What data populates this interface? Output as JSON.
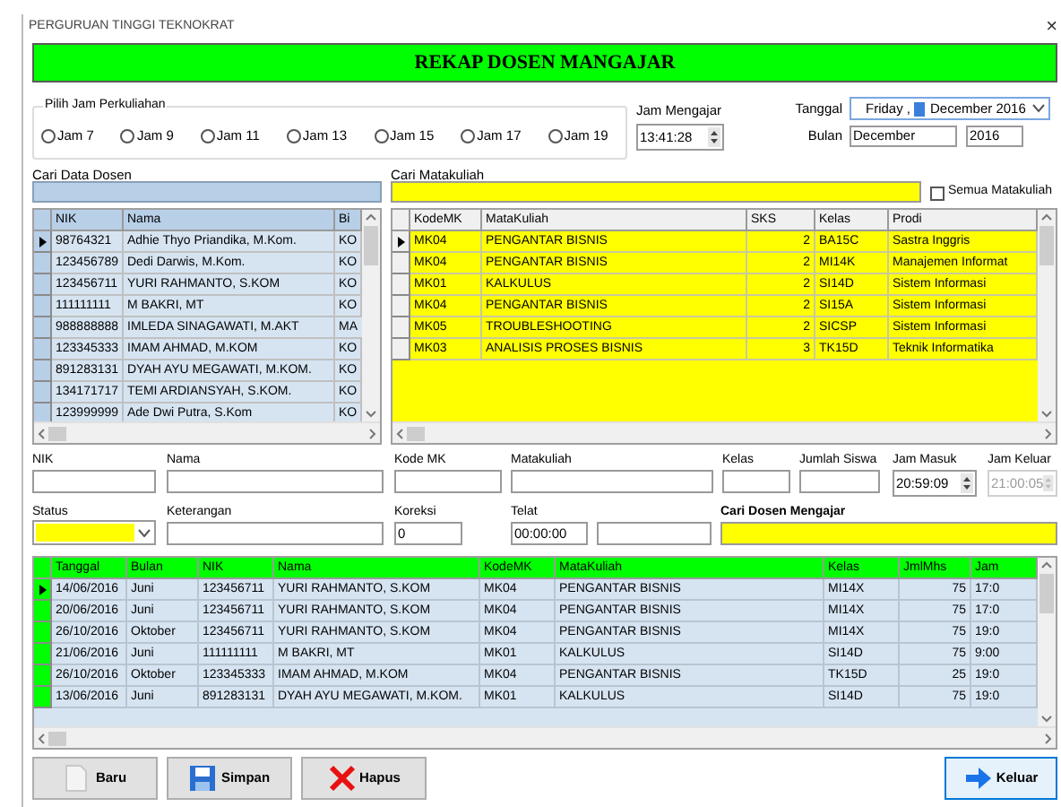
{
  "window": {
    "title": "PERGURUAN TINGGI TEKNOKRAT",
    "close": "×"
  },
  "banner": {
    "title": "REKAP DOSEN MANGAJAR"
  },
  "jam_group": {
    "label": "Pilih Jam Perkuliahan",
    "options": [
      {
        "label": "Jam 7",
        "selected": false
      },
      {
        "label": "Jam 9",
        "selected": false
      },
      {
        "label": "Jam 11",
        "selected": false
      },
      {
        "label": "Jam 13",
        "selected": false
      },
      {
        "label": "Jam 15",
        "selected": false
      },
      {
        "label": "Jam 17",
        "selected": false
      },
      {
        "label": "Jam 19",
        "selected": false
      }
    ]
  },
  "jam_mengajar": {
    "label": "Jam Mengajar",
    "value": "13:41:28"
  },
  "tanggal": {
    "label": "Tanggal",
    "day": "Friday ,",
    "date": "December 2016"
  },
  "bulan": {
    "label": "Bulan",
    "month": "December",
    "year": "2016"
  },
  "cari_dosen": {
    "label": "Cari Data Dosen"
  },
  "cari_matakuliah": {
    "label": "Cari Matakuliah"
  },
  "semua_matakuliah": {
    "label": "Semua Matakuliah",
    "checked": false
  },
  "dosen_table": {
    "columns": [
      "NIK",
      "Nama",
      "Bi"
    ],
    "rows": [
      {
        "current": true,
        "cells": [
          "98764321",
          "Adhie Thyo Priandika, M.Kom.",
          "KO"
        ]
      },
      {
        "current": false,
        "cells": [
          "123456789",
          "Dedi Darwis, M.Kom.",
          "KO"
        ]
      },
      {
        "current": false,
        "cells": [
          "123456711",
          "YURI RAHMANTO, S.KOM",
          "KO"
        ]
      },
      {
        "current": false,
        "cells": [
          "111111111",
          "M BAKRI, MT",
          "KO"
        ]
      },
      {
        "current": false,
        "cells": [
          "988888888",
          "IMLEDA SINAGAWATI, M.AKT",
          "MA"
        ]
      },
      {
        "current": false,
        "cells": [
          "123345333",
          "IMAM AHMAD, M.KOM",
          "KO"
        ]
      },
      {
        "current": false,
        "cells": [
          "891283131",
          "DYAH AYU MEGAWATI, M.KOM.",
          "KO"
        ]
      },
      {
        "current": false,
        "cells": [
          "134171717",
          "TEMI ARDIANSYAH, S.KOM.",
          "KO"
        ]
      },
      {
        "current": false,
        "cells": [
          "123999999",
          "Ade Dwi Putra, S.Kom",
          "KO"
        ]
      }
    ]
  },
  "matakuliah_table": {
    "columns": [
      "KodeMK",
      "MataKuliah",
      "SKS",
      "Kelas",
      "Prodi"
    ],
    "rows": [
      {
        "current": true,
        "cells": [
          "MK04",
          "PENGANTAR BISNIS",
          "2",
          "BA15C",
          "Sastra Inggris"
        ]
      },
      {
        "current": false,
        "cells": [
          "MK04",
          "PENGANTAR BISNIS",
          "2",
          "MI14K",
          "Manajemen Informat"
        ]
      },
      {
        "current": false,
        "cells": [
          "MK01",
          "KALKULUS",
          "2",
          "SI14D",
          "Sistem Informasi"
        ]
      },
      {
        "current": false,
        "cells": [
          "MK04",
          "PENGANTAR BISNIS",
          "2",
          "SI15A",
          "Sistem Informasi"
        ]
      },
      {
        "current": false,
        "cells": [
          "MK05",
          "TROUBLESHOOTING",
          "2",
          "SICSP",
          "Sistem Informasi"
        ]
      },
      {
        "current": false,
        "cells": [
          "MK03",
          "ANALISIS PROSES BISNIS",
          "3",
          "TK15D",
          "Teknik Informatika"
        ]
      }
    ]
  },
  "form_row_1": [
    {
      "kind": "text",
      "label": "NIK"
    },
    {
      "kind": "text",
      "label": "Nama"
    },
    {
      "kind": "text",
      "label": "Kode MK"
    },
    {
      "kind": "text",
      "label": "Matakuliah"
    },
    {
      "kind": "text",
      "label": "Kelas"
    },
    {
      "kind": "text",
      "label": "Jumlah Siswa"
    },
    {
      "kind": "spin",
      "label": "Jam Masuk",
      "value": "20:59:09",
      "disabled": false
    },
    {
      "kind": "spin",
      "label": "Jam Keluar",
      "value": "21:00:05",
      "disabled": true
    }
  ],
  "form_row_2": [
    {
      "kind": "combo",
      "label": "Status"
    },
    {
      "kind": "text",
      "label": "Keterangan"
    },
    {
      "kind": "text",
      "label": "Koreksi",
      "value": "0"
    },
    {
      "kind": "text",
      "label": "Telat",
      "value": "00:00:00"
    },
    {
      "kind": "text"
    },
    {
      "kind": "search",
      "label": "Cari Dosen Mengajar"
    }
  ],
  "rekap_table": {
    "columns": [
      "Tanggal",
      "Bulan",
      "NIK",
      "Nama",
      "KodeMK",
      "MataKuliah",
      "Kelas",
      "JmlMhs",
      "Jam"
    ],
    "rows": [
      {
        "current": true,
        "cells": [
          "14/06/2016",
          "Juni",
          "123456711",
          "YURI RAHMANTO, S.KOM",
          "MK04",
          "PENGANTAR BISNIS",
          "MI14X",
          "75",
          "17:0"
        ]
      },
      {
        "current": false,
        "cells": [
          "20/06/2016",
          "Juni",
          "123456711",
          "YURI RAHMANTO, S.KOM",
          "MK04",
          "PENGANTAR BISNIS",
          "MI14X",
          "75",
          "17:0"
        ]
      },
      {
        "current": false,
        "cells": [
          "26/10/2016",
          "Oktober",
          "123456711",
          "YURI RAHMANTO, S.KOM",
          "MK04",
          "PENGANTAR BISNIS",
          "MI14X",
          "75",
          "19:0"
        ]
      },
      {
        "current": false,
        "cells": [
          "21/06/2016",
          "Juni",
          "111111111",
          "M BAKRI, MT",
          "MK01",
          "KALKULUS",
          "SI14D",
          "75",
          "9:00"
        ]
      },
      {
        "current": false,
        "cells": [
          "26/10/2016",
          "Oktober",
          "123345333",
          "IMAM AHMAD, M.KOM",
          "MK04",
          "PENGANTAR BISNIS",
          "TK15D",
          "25",
          "19:0"
        ]
      },
      {
        "current": false,
        "cells": [
          "13/06/2016",
          "Juni",
          "891283131",
          "DYAH AYU MEGAWATI, M.KOM.",
          "MK01",
          "KALKULUS",
          "SI14D",
          "75",
          "19:0"
        ]
      }
    ]
  },
  "buttons": [
    {
      "kind": "new",
      "label": "Baru",
      "focused": false
    },
    {
      "kind": "save",
      "label": "Simpan",
      "focused": false
    },
    {
      "kind": "delete",
      "label": "Hapus",
      "focused": false
    },
    {
      "kind": "exit",
      "label": "Keluar",
      "focused": true
    }
  ]
}
